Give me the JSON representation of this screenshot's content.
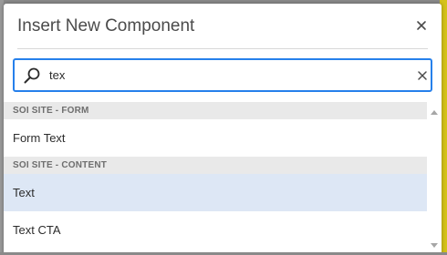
{
  "dialog": {
    "title": "Insert New Component",
    "close_icon": "close-icon"
  },
  "search": {
    "value": "tex",
    "placeholder": "",
    "icon": "search-icon",
    "clear_icon": "clear-icon"
  },
  "groups": [
    {
      "header": "SOI SITE - FORM",
      "items": [
        {
          "label": "Form Text"
        }
      ]
    },
    {
      "header": "SOI SITE - CONTENT",
      "items": [
        {
          "label": "Text"
        },
        {
          "label": "Text CTA"
        }
      ]
    }
  ],
  "colors": {
    "accent": "#2680eb",
    "selected_row": "#dde7f5",
    "group_header_bg": "#e9e9e9"
  }
}
